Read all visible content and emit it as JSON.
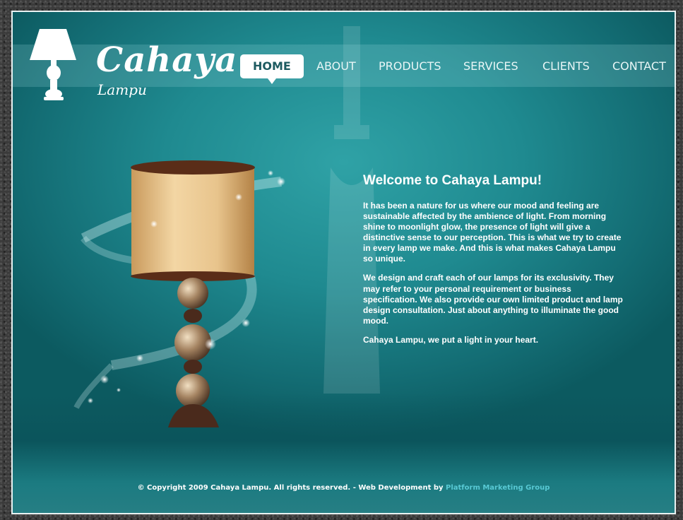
{
  "logo": {
    "main": "Cahaya",
    "sub": "Lampu",
    "icon": "table-lamp-icon"
  },
  "nav": {
    "items": [
      {
        "label": "HOME",
        "active": true
      },
      {
        "label": "ABOUT",
        "active": false
      },
      {
        "label": "PRODUCTS",
        "active": false
      },
      {
        "label": "SERVICES",
        "active": false
      },
      {
        "label": "CLIENTS",
        "active": false
      },
      {
        "label": "CONTACT",
        "active": false
      }
    ]
  },
  "main": {
    "title": "Welcome to Cahaya Lampu!",
    "paragraphs": [
      "It has been a nature for us where our mood and feeling are sustainable affected by the ambience of light. From morning shine to moonlight glow, the presence of light will give a distinctive sense to our perception. This is what we try to create in every lamp we make. And this is what makes Cahaya Lampu so unique.",
      "We design and craft each of our lamps for its exclusivity. They may refer to your personal requirement or business specification. We also provide our own limited product and lamp design consultation. Just about anything to illuminate the good mood.",
      "Cahaya Lampu, we put a light in your heart."
    ],
    "image": "decorative-lamp-image"
  },
  "footer": {
    "text": "© Copyright 2009 Cahaya Lampu. All rights reserved. - Web Development by",
    "link": "Platform Marketing Group"
  },
  "colors": {
    "background": "#1f8a90",
    "nav_active_bg": "#ffffff",
    "text": "#ffffff",
    "footer_link": "#58c9d4"
  }
}
